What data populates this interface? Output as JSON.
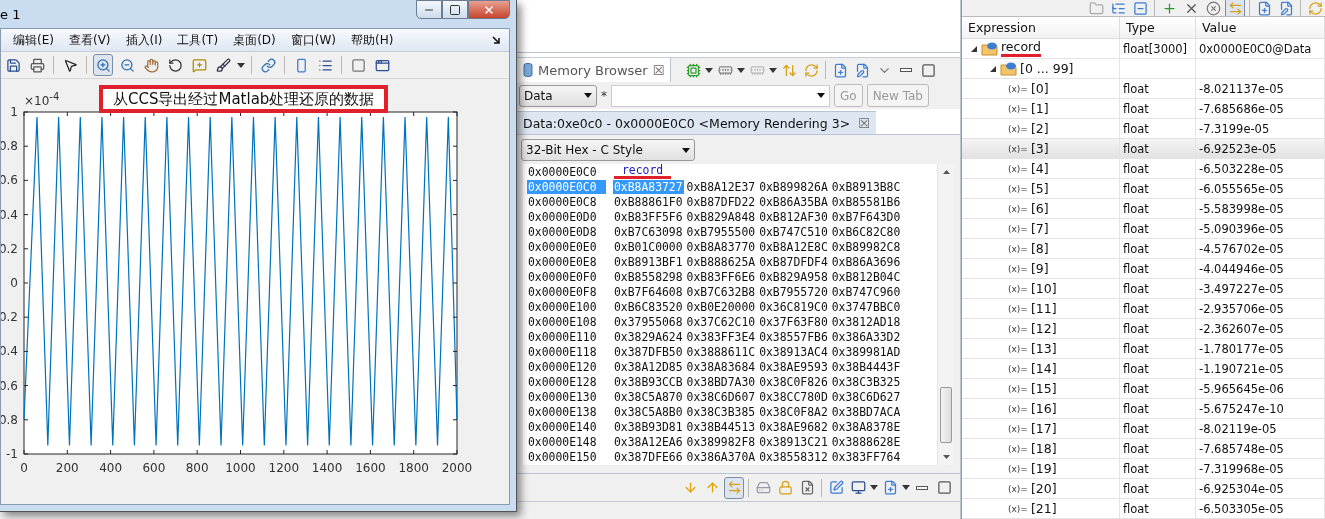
{
  "figure": {
    "title": "e 1",
    "window_controls": [
      {
        "kind": "minimize"
      },
      {
        "kind": "maximize"
      },
      {
        "kind": "close"
      }
    ],
    "menu": [
      "编辑(E)",
      "查看(V)",
      "插入(I)",
      "工具(T)",
      "桌面(D)",
      "窗口(W)",
      "帮助(H)"
    ],
    "toolbar": [
      {
        "kind": "save",
        "selected": false
      },
      {
        "kind": "print",
        "selected": false
      },
      {
        "kind": "sep"
      },
      {
        "kind": "pointer",
        "selected": false
      },
      {
        "kind": "sep"
      },
      {
        "kind": "zoom_in",
        "selected": true
      },
      {
        "kind": "zoom_out",
        "selected": false
      },
      {
        "kind": "pan",
        "selected": false
      },
      {
        "kind": "rotate",
        "selected": false
      },
      {
        "kind": "datatip",
        "selected": false
      },
      {
        "kind": "brush",
        "selected": false
      },
      {
        "kind": "dropdown"
      },
      {
        "kind": "sep"
      },
      {
        "kind": "link",
        "selected": false
      },
      {
        "kind": "sep"
      },
      {
        "kind": "colorbar",
        "selected": false
      },
      {
        "kind": "legend",
        "selected": false
      },
      {
        "kind": "sep"
      },
      {
        "kind": "hide",
        "selected": false
      },
      {
        "kind": "plot_tools",
        "selected": false
      }
    ],
    "annotation": {
      "text": "从CCS导出经过Matlab处理还原的数据",
      "highlighted": true
    },
    "y_multiplier": "×10$^{-4}$",
    "chart_data": {
      "type": "line",
      "xlim": [
        0,
        2000
      ],
      "ylim": [
        -1,
        1
      ],
      "xticks": [
        0,
        200,
        400,
        600,
        800,
        1000,
        1200,
        1400,
        1600,
        1800,
        2000
      ],
      "yticks": [
        {
          "value": 1,
          "label": "1"
        },
        {
          "value": 0.8,
          "label": "0.8"
        },
        {
          "value": 0.6,
          "label": "0.6"
        },
        {
          "value": 0.4,
          "label": "0.4"
        },
        {
          "value": 0.2,
          "label": "0.2"
        },
        {
          "value": 0,
          "label": "0"
        },
        {
          "value": -0.2,
          "label": "0.2"
        },
        {
          "value": -0.4,
          "label": "0.4"
        },
        {
          "value": -0.6,
          "label": "0.6"
        },
        {
          "value": -0.8,
          "label": "0.8"
        },
        {
          "value": -1,
          "label": "-1"
        }
      ],
      "x": [
        0,
        60,
        110,
        160,
        210,
        260,
        310,
        360,
        410,
        460,
        510,
        560,
        610,
        660,
        710,
        760,
        810,
        860,
        910,
        960,
        1010,
        1060,
        1110,
        1160,
        1210,
        1260,
        1310,
        1360,
        1410,
        1460,
        1510,
        1560,
        1610,
        1660,
        1710,
        1760,
        1810,
        1860,
        1910,
        1960,
        2000
      ],
      "series": [
        {
          "color": "#0072bd",
          "values": [
            -0.8,
            0.97,
            -0.95,
            0.97,
            -0.95,
            0.97,
            -0.95,
            0.97,
            -0.95,
            0.97,
            -0.95,
            0.97,
            -0.95,
            0.97,
            -0.95,
            0.97,
            -0.95,
            0.97,
            -0.95,
            0.97,
            -0.95,
            0.97,
            -0.95,
            0.97,
            -0.95,
            0.97,
            -0.95,
            0.97,
            -0.95,
            0.97,
            -0.95,
            0.97,
            -0.95,
            0.97,
            -0.95,
            0.97,
            -0.95,
            0.97,
            -0.95,
            0.97,
            -0.8
          ]
        }
      ]
    }
  },
  "memory_browser": {
    "tab": {
      "label": "Memory Browser",
      "close": "☒"
    },
    "toolbar": [
      {
        "kind": "chip",
        "selected": false
      },
      {
        "kind": "dropdown"
      },
      {
        "kind": "memory",
        "selected": false
      },
      {
        "kind": "dropdown"
      },
      {
        "kind": "memory_grey",
        "selected": false
      },
      {
        "kind": "dropdown"
      },
      {
        "kind": "swap",
        "selected": false
      },
      {
        "kind": "refresh",
        "selected": false
      },
      {
        "kind": "sep"
      },
      {
        "kind": "new_view",
        "selected": false
      },
      {
        "kind": "edit_view",
        "selected": false
      },
      {
        "kind": "view_menu",
        "selected": false
      },
      {
        "kind": "minimize",
        "selected": false
      },
      {
        "kind": "maximize",
        "selected": false
      }
    ],
    "page": "Data",
    "star": "*",
    "go": {
      "label": "Go",
      "disabled": true
    },
    "new_tab": {
      "label": "New Tab",
      "disabled": true
    },
    "rendering_tab": {
      "label": "Data:0xe0c0 - 0x0000E0C0 <Memory Rendering 3>",
      "close": "☒"
    },
    "format": "32-Bit Hex - C Style",
    "label_row": {
      "address": "0x0000E0C0",
      "label": "record",
      "underlined": true
    },
    "rows": [
      {
        "address": "0x0000E0C0",
        "words": [
          "0xB8A83727",
          "0xB8A12E37",
          "0xB899826A",
          "0xB8913B8C"
        ],
        "selected": true
      },
      {
        "address": "0x0000E0C8",
        "words": [
          "0xB88861F0",
          "0xB87DFD22",
          "0xB86A35BA",
          "0xB85581B6"
        ],
        "selected": false
      },
      {
        "address": "0x0000E0D0",
        "words": [
          "0xB83FF5F6",
          "0xB829A848",
          "0xB812AF30",
          "0xB7F643D0"
        ],
        "selected": false
      },
      {
        "address": "0x0000E0D8",
        "words": [
          "0xB7C63098",
          "0xB7955500",
          "0xB747C510",
          "0xB6C82C80"
        ],
        "selected": false
      },
      {
        "address": "0x0000E0E0",
        "words": [
          "0xB01C0000",
          "0xB8A83770",
          "0xB8A12E8C",
          "0xB89982C8"
        ],
        "selected": false
      },
      {
        "address": "0x0000E0E8",
        "words": [
          "0xB8913BF1",
          "0xB888625A",
          "0xB87DFDF4",
          "0xB86A3696"
        ],
        "selected": false
      },
      {
        "address": "0x0000E0F0",
        "words": [
          "0xB8558298",
          "0xB83FF6E6",
          "0xB829A958",
          "0xB812B04C"
        ],
        "selected": false
      },
      {
        "address": "0x0000E0F8",
        "words": [
          "0xB7F64608",
          "0xB7C632B8",
          "0xB7955720",
          "0xB747C960"
        ],
        "selected": false
      },
      {
        "address": "0x0000E100",
        "words": [
          "0xB6C83520",
          "0xB0E20000",
          "0x36C819C0",
          "0x3747BBC0"
        ],
        "selected": false
      },
      {
        "address": "0x0000E108",
        "words": [
          "0x37955068",
          "0x37C62C10",
          "0x37F63F80",
          "0x3812AD18"
        ],
        "selected": false
      },
      {
        "address": "0x0000E110",
        "words": [
          "0x3829A624",
          "0x383FF3E4",
          "0x38557FB6",
          "0x386A33D2"
        ],
        "selected": false
      },
      {
        "address": "0x0000E118",
        "words": [
          "0x387DFB50",
          "0x3888611C",
          "0x38913AC4",
          "0x389981AD"
        ],
        "selected": false
      },
      {
        "address": "0x0000E120",
        "words": [
          "0x38A12D85",
          "0x38A83684",
          "0x38AE9593",
          "0x38B4443F"
        ],
        "selected": false
      },
      {
        "address": "0x0000E128",
        "words": [
          "0x38B93CCB",
          "0x38BD7A30",
          "0x38C0F826",
          "0x38C3B325"
        ],
        "selected": false
      },
      {
        "address": "0x0000E130",
        "words": [
          "0x38C5A870",
          "0x38C6D607",
          "0x38CC780D",
          "0x38C6D627"
        ],
        "selected": false
      },
      {
        "address": "0x0000E138",
        "words": [
          "0x38C5A8B0",
          "0x38C3B385",
          "0x38C0F8A2",
          "0x38BD7ACA"
        ],
        "selected": false
      },
      {
        "address": "0x0000E140",
        "words": [
          "0x38B93D81",
          "0x38B44513",
          "0x38AE9682",
          "0x38A8378E"
        ],
        "selected": false
      },
      {
        "address": "0x0000E148",
        "words": [
          "0x38A12EA6",
          "0x389982F8",
          "0x38913C21",
          "0x3888628E"
        ],
        "selected": false
      },
      {
        "address": "0x0000E150",
        "words": [
          "0x387DFE66",
          "0x386A370A",
          "0x38558312",
          "0x383FF764"
        ],
        "selected": false
      }
    ],
    "bottom_toolbar": [
      {
        "kind": "arrow_down",
        "selected": false
      },
      {
        "kind": "arrow_up",
        "selected": false
      },
      {
        "kind": "sync",
        "selected": true
      },
      {
        "kind": "sep"
      },
      {
        "kind": "save_mem",
        "selected": false
      },
      {
        "kind": "lock",
        "selected": false
      },
      {
        "kind": "clear",
        "selected": false
      },
      {
        "kind": "sep"
      },
      {
        "kind": "pin",
        "selected": false
      },
      {
        "kind": "monitor",
        "selected": false
      },
      {
        "kind": "dropdown"
      },
      {
        "kind": "new_view",
        "selected": false
      },
      {
        "kind": "dropdown"
      },
      {
        "kind": "minimize",
        "selected": false
      },
      {
        "kind": "maximize",
        "selected": false
      }
    ]
  },
  "expressions": {
    "toolbar": [
      {
        "kind": "folder",
        "selected": false
      },
      {
        "kind": "expand_all",
        "selected": false
      },
      {
        "kind": "collapse",
        "selected": false
      },
      {
        "kind": "sep"
      },
      {
        "kind": "add",
        "selected": false
      },
      {
        "kind": "remove",
        "selected": false
      },
      {
        "kind": "remove_all",
        "selected": false
      },
      {
        "kind": "sync",
        "selected": true
      },
      {
        "kind": "sep"
      },
      {
        "kind": "new_view",
        "selected": false
      },
      {
        "kind": "edit_view",
        "selected": false
      },
      {
        "kind": "sep"
      },
      {
        "kind": "refresh",
        "selected": false
      }
    ],
    "columns": [
      "Expression",
      "Type",
      "Value"
    ],
    "tree": [
      {
        "kind": "group",
        "expression": "record",
        "type": "float[3000]",
        "value": "0x0000E0C0@Data",
        "expanded": true,
        "selected": false,
        "underlined": true,
        "children": [
          {
            "kind": "group",
            "expression": "[0 ... 99]",
            "expanded": true,
            "selected": false,
            "underlined": false,
            "children": [
              {
                "kind": "variable",
                "icon": "(x)=",
                "expression": "[0]",
                "type": "float",
                "value": "-8.021137e-05",
                "selected": false
              },
              {
                "kind": "variable",
                "icon": "(x)=",
                "expression": "[1]",
                "type": "float",
                "value": "-7.685686e-05",
                "selected": false
              },
              {
                "kind": "variable",
                "icon": "(x)=",
                "expression": "[2]",
                "type": "float",
                "value": "-7.3199e-05",
                "selected": false
              },
              {
                "kind": "variable",
                "icon": "(x)=",
                "expression": "[3]",
                "type": "float",
                "value": "-6.92523e-05",
                "selected": true
              },
              {
                "kind": "variable",
                "icon": "(x)=",
                "expression": "[4]",
                "type": "float",
                "value": "-6.503228e-05",
                "selected": false
              },
              {
                "kind": "variable",
                "icon": "(x)=",
                "expression": "[5]",
                "type": "float",
                "value": "-6.055565e-05",
                "selected": false
              },
              {
                "kind": "variable",
                "icon": "(x)=",
                "expression": "[6]",
                "type": "float",
                "value": "-5.583998e-05",
                "selected": false
              },
              {
                "kind": "variable",
                "icon": "(x)=",
                "expression": "[7]",
                "type": "float",
                "value": "-5.090396e-05",
                "selected": false
              },
              {
                "kind": "variable",
                "icon": "(x)=",
                "expression": "[8]",
                "type": "float",
                "value": "-4.576702e-05",
                "selected": false
              },
              {
                "kind": "variable",
                "icon": "(x)=",
                "expression": "[9]",
                "type": "float",
                "value": "-4.044946e-05",
                "selected": false
              },
              {
                "kind": "variable",
                "icon": "(x)=",
                "expression": "[10]",
                "type": "float",
                "value": "-3.497227e-05",
                "selected": false
              },
              {
                "kind": "variable",
                "icon": "(x)=",
                "expression": "[11]",
                "type": "float",
                "value": "-2.935706e-05",
                "selected": false
              },
              {
                "kind": "variable",
                "icon": "(x)=",
                "expression": "[12]",
                "type": "float",
                "value": "-2.362607e-05",
                "selected": false
              },
              {
                "kind": "variable",
                "icon": "(x)=",
                "expression": "[13]",
                "type": "float",
                "value": "-1.780177e-05",
                "selected": false
              },
              {
                "kind": "variable",
                "icon": "(x)=",
                "expression": "[14]",
                "type": "float",
                "value": "-1.190721e-05",
                "selected": false
              },
              {
                "kind": "variable",
                "icon": "(x)=",
                "expression": "[15]",
                "type": "float",
                "value": "-5.965645e-06",
                "selected": false
              },
              {
                "kind": "variable",
                "icon": "(x)=",
                "expression": "[16]",
                "type": "float",
                "value": "-5.675247e-10",
                "selected": false
              },
              {
                "kind": "variable",
                "icon": "(x)=",
                "expression": "[17]",
                "type": "float",
                "value": "-8.02119e-05",
                "selected": false
              },
              {
                "kind": "variable",
                "icon": "(x)=",
                "expression": "[18]",
                "type": "float",
                "value": "-7.685748e-05",
                "selected": false
              },
              {
                "kind": "variable",
                "icon": "(x)=",
                "expression": "[19]",
                "type": "float",
                "value": "-7.319968e-05",
                "selected": false
              },
              {
                "kind": "variable",
                "icon": "(x)=",
                "expression": "[20]",
                "type": "float",
                "value": "-6.925304e-05",
                "selected": false
              },
              {
                "kind": "variable",
                "icon": "(x)=",
                "expression": "[21]",
                "type": "float",
                "value": "-6.503305e-05",
                "selected": false
              }
            ]
          }
        ]
      }
    ]
  }
}
